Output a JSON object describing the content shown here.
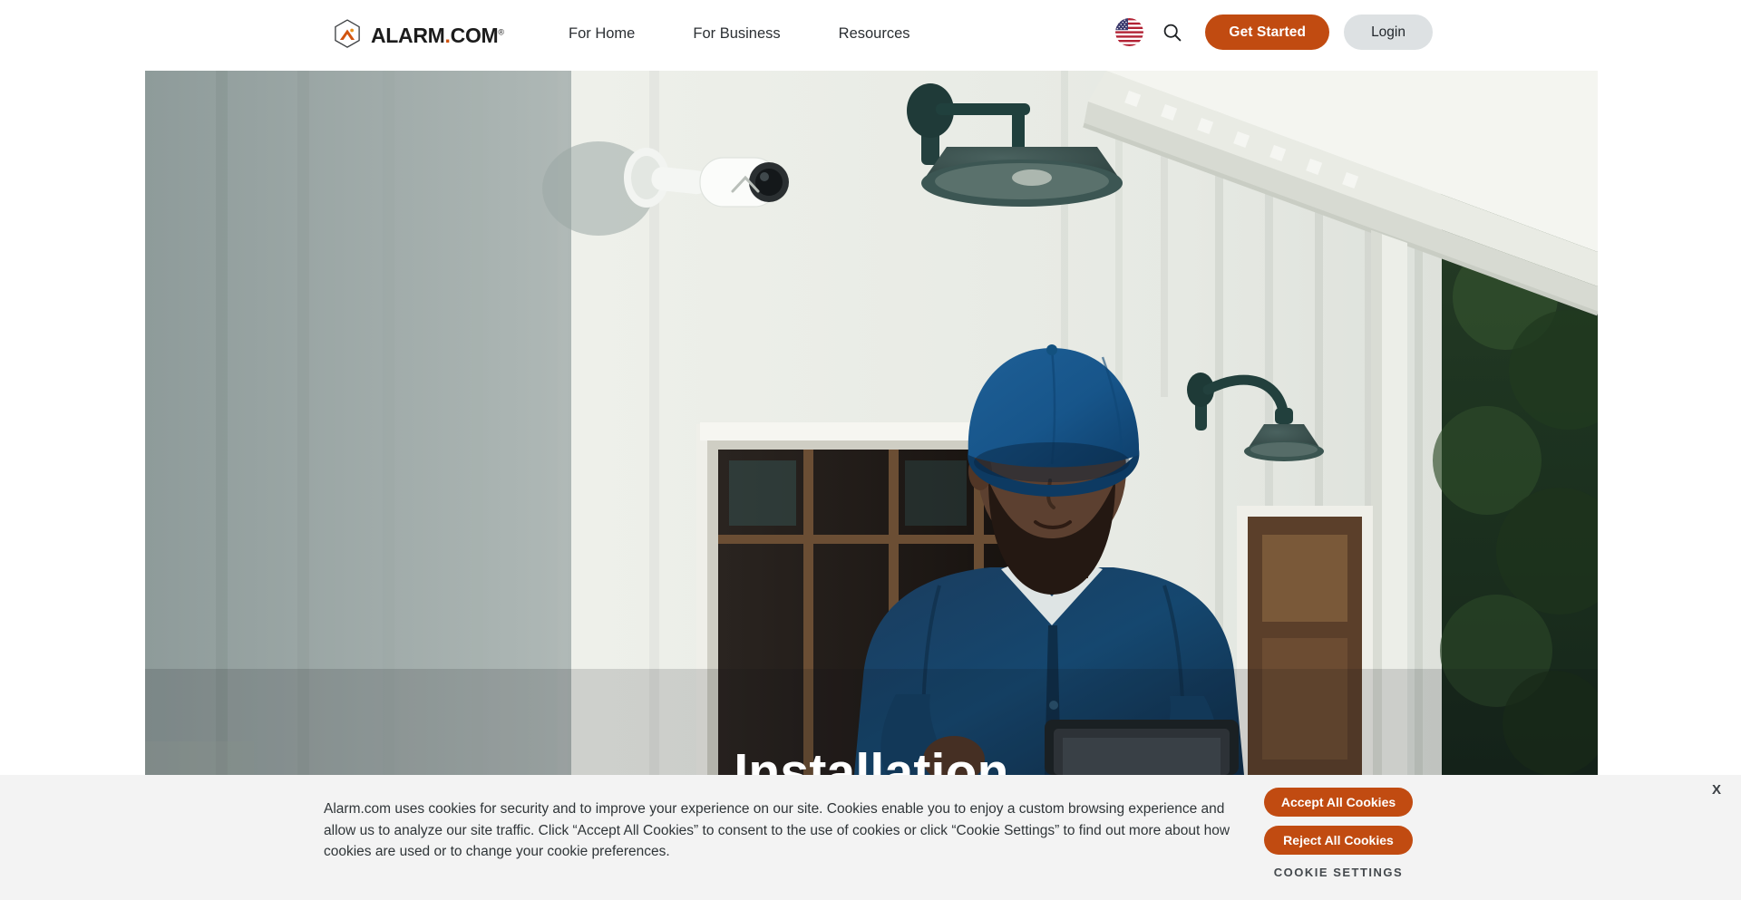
{
  "brand": {
    "accent_orange": "#c14b11",
    "logo_text": "ALARM",
    "logo_dot": ".",
    "logo_text2": "COM",
    "logo_registered": "®",
    "logo_icon": "alarm-hexagon-logo"
  },
  "header": {
    "nav": [
      {
        "label": "For Home"
      },
      {
        "label": "For Business"
      },
      {
        "label": "Resources"
      }
    ],
    "locale_icon": "us-flag-icon",
    "search_icon": "search-icon",
    "get_started_label": "Get Started",
    "login_label": "Login"
  },
  "hero": {
    "alt": "Technician in blue cap and blue work shirt installing a white security camera on a white board-and-batten house exterior with dark teal barn lights",
    "caption": "Installation"
  },
  "cookie_banner": {
    "body": "Alarm.com uses cookies for security and to improve your experience on our site. Cookies enable you to enjoy a custom browsing experience and allow us to analyze our site traffic. Click “Accept All Cookies” to consent to the use of cookies or click “Cookie Settings” to find out more about how cookies are used or to change your cookie preferences.",
    "accept_label": "Accept All Cookies",
    "reject_label": "Reject All Cookies",
    "settings_label": "COOKIE SETTINGS",
    "close_label": "X"
  }
}
